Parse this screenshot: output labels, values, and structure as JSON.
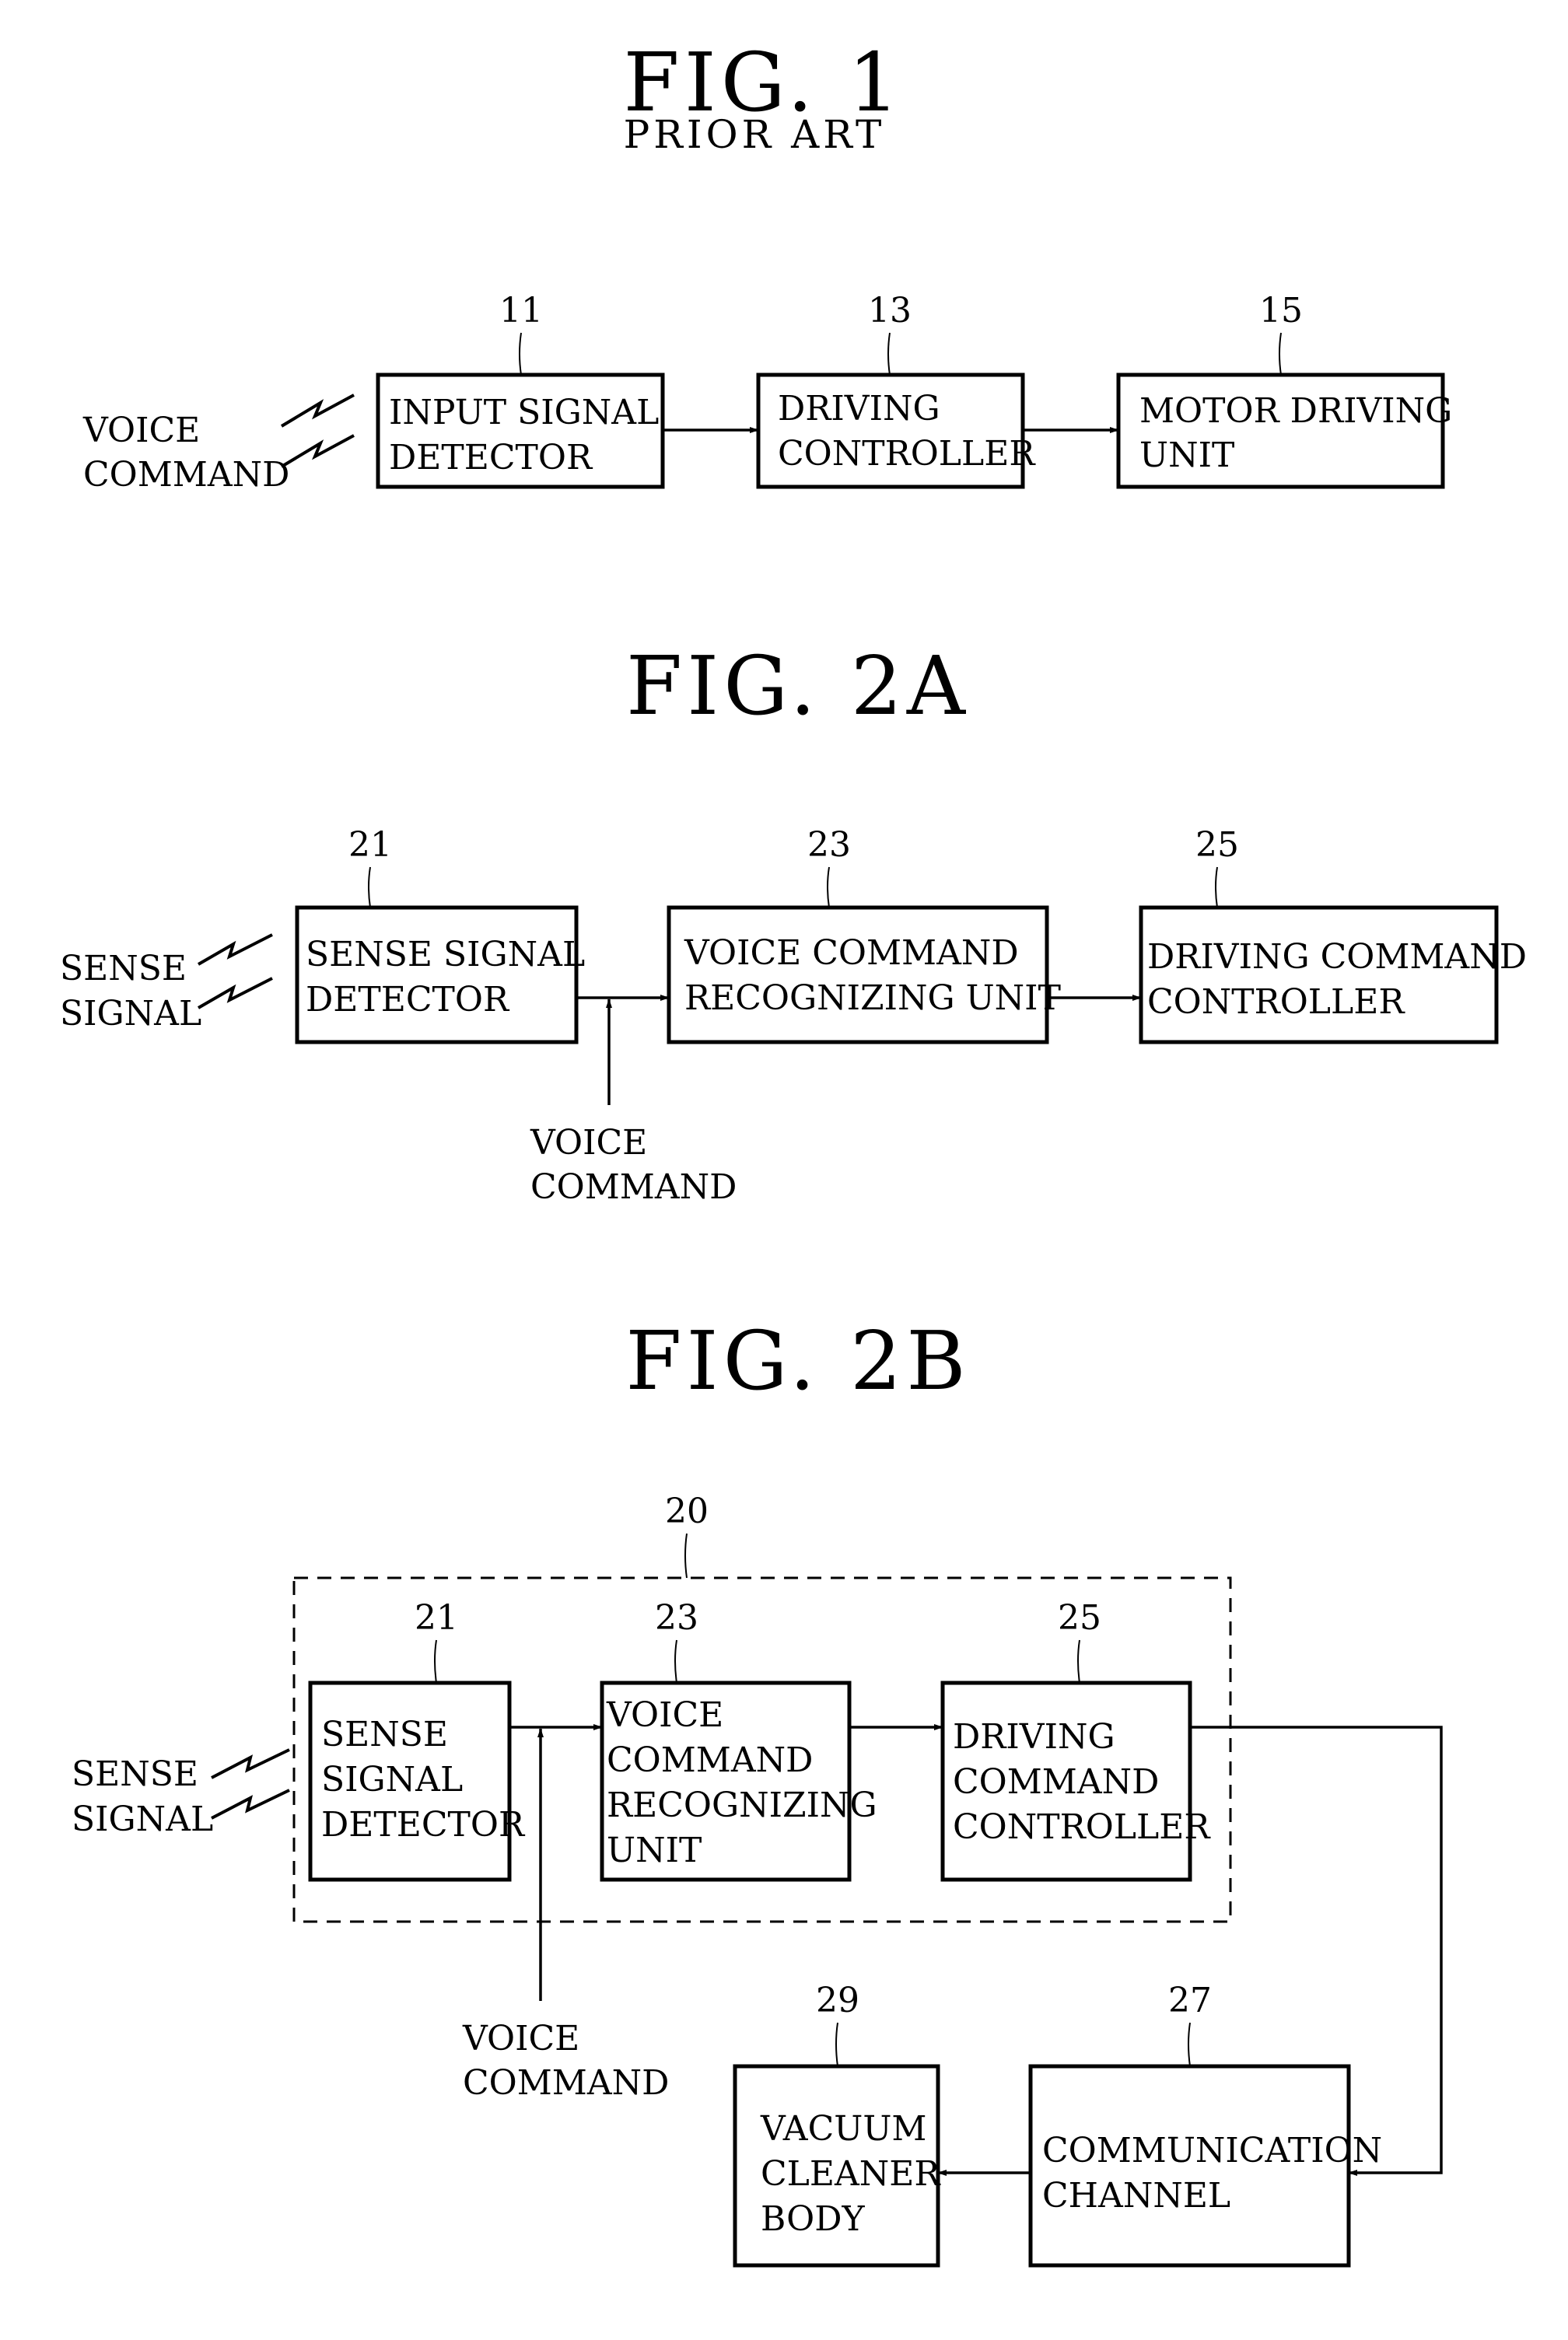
{
  "figures": [
    {
      "id": "fig1",
      "title": "FIG. 1",
      "subtitle": "PRIOR ART",
      "input_label": [
        "VOICE",
        "COMMAND"
      ],
      "blocks": [
        {
          "ref": "11",
          "lines": [
            "INPUT SIGNAL",
            "DETECTOR"
          ]
        },
        {
          "ref": "13",
          "lines": [
            "DRIVING",
            "CONTROLLER"
          ]
        },
        {
          "ref": "15",
          "lines": [
            "MOTOR DRIVING",
            "UNIT"
          ]
        }
      ],
      "connections": [
        [
          "11",
          "13"
        ],
        [
          "13",
          "15"
        ]
      ]
    },
    {
      "id": "fig2a",
      "title": "FIG. 2A",
      "input_label": [
        "SENSE",
        "SIGNAL"
      ],
      "side_input_label": [
        "VOICE",
        "COMMAND"
      ],
      "blocks": [
        {
          "ref": "21",
          "lines": [
            "SENSE SIGNAL",
            "DETECTOR"
          ]
        },
        {
          "ref": "23",
          "lines": [
            "VOICE COMMAND",
            "RECOGNIZING UNIT"
          ]
        },
        {
          "ref": "25",
          "lines": [
            "DRIVING COMMAND",
            "CONTROLLER"
          ]
        }
      ],
      "connections": [
        [
          "21",
          "23"
        ],
        [
          "23",
          "25"
        ]
      ]
    },
    {
      "id": "fig2b",
      "title": "FIG. 2B",
      "group_ref": "20",
      "input_label": [
        "SENSE",
        "SIGNAL"
      ],
      "side_input_label": [
        "VOICE",
        "COMMAND"
      ],
      "blocks": [
        {
          "ref": "21",
          "lines": [
            "SENSE",
            "SIGNAL",
            "DETECTOR"
          ]
        },
        {
          "ref": "23",
          "lines": [
            "VOICE",
            "COMMAND",
            "RECOGNIZING",
            "UNIT"
          ]
        },
        {
          "ref": "25",
          "lines": [
            "DRIVING",
            "COMMAND",
            "CONTROLLER"
          ]
        },
        {
          "ref": "27",
          "lines": [
            "COMMUNICATION",
            "CHANNEL"
          ]
        },
        {
          "ref": "29",
          "lines": [
            "VACUUM",
            "CLEANER",
            "BODY"
          ]
        }
      ],
      "connections": [
        [
          "21",
          "23"
        ],
        [
          "23",
          "25"
        ],
        [
          "25",
          "27"
        ],
        [
          "27",
          "29"
        ]
      ]
    }
  ]
}
